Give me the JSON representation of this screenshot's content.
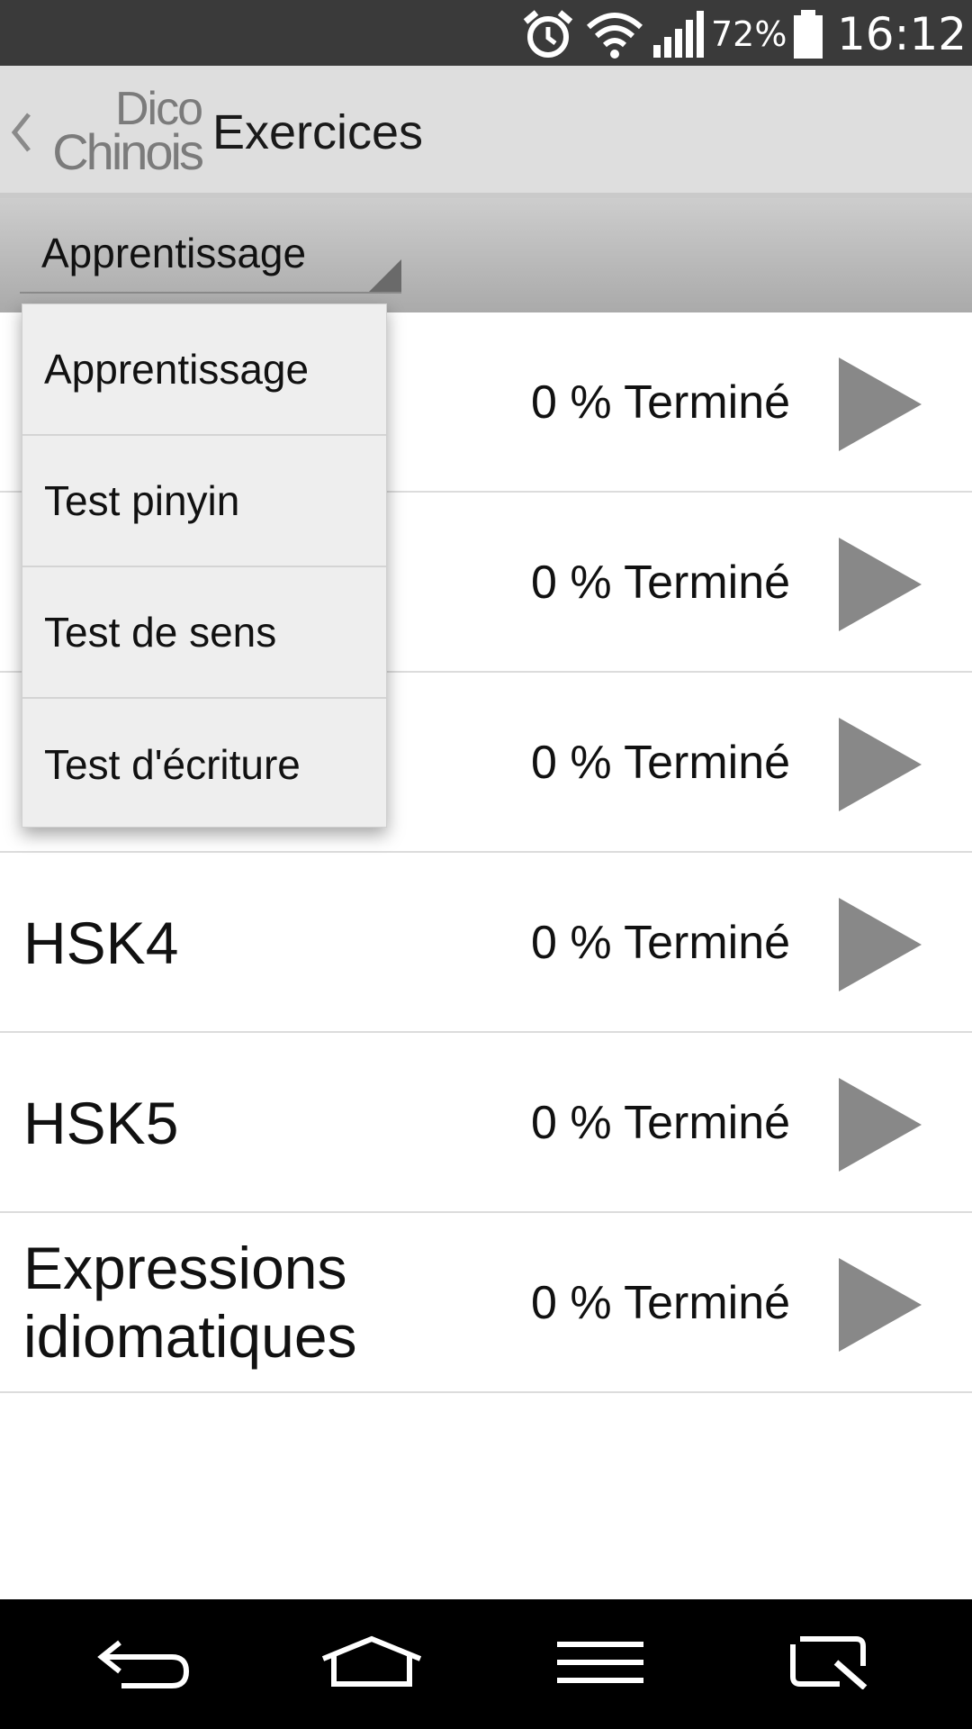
{
  "status_bar": {
    "battery_percent": "72%",
    "time": "16:12",
    "icons": [
      "alarm-icon",
      "wifi-icon",
      "signal-icon",
      "battery-icon"
    ]
  },
  "action_bar": {
    "logo_line1": "Dico",
    "logo_line2": "Chinois",
    "title": "Exercices"
  },
  "spinner": {
    "selected": "Apprentissage"
  },
  "dropdown": {
    "options": [
      "Apprentissage",
      "Test pinyin",
      "Test de sens",
      "Test d'écriture"
    ]
  },
  "list": {
    "rows": [
      {
        "name": "",
        "progress": "0 % Terminé"
      },
      {
        "name": "",
        "progress": "0 % Terminé"
      },
      {
        "name": "",
        "progress": "0 % Terminé"
      },
      {
        "name": "HSK4",
        "progress": "0 % Terminé"
      },
      {
        "name": "HSK5",
        "progress": "0 % Terminé"
      },
      {
        "name": "Expressions idiomatiques",
        "progress": "0 % Terminé"
      }
    ]
  },
  "nav_bar": {
    "buttons": [
      "back-icon",
      "home-icon",
      "menu-icon",
      "qslide-icon"
    ]
  },
  "colors": {
    "status_bar": "#3a3a3a",
    "action_bar": "#dedede",
    "play_icon": "#888888",
    "nav_bar": "#000000"
  }
}
